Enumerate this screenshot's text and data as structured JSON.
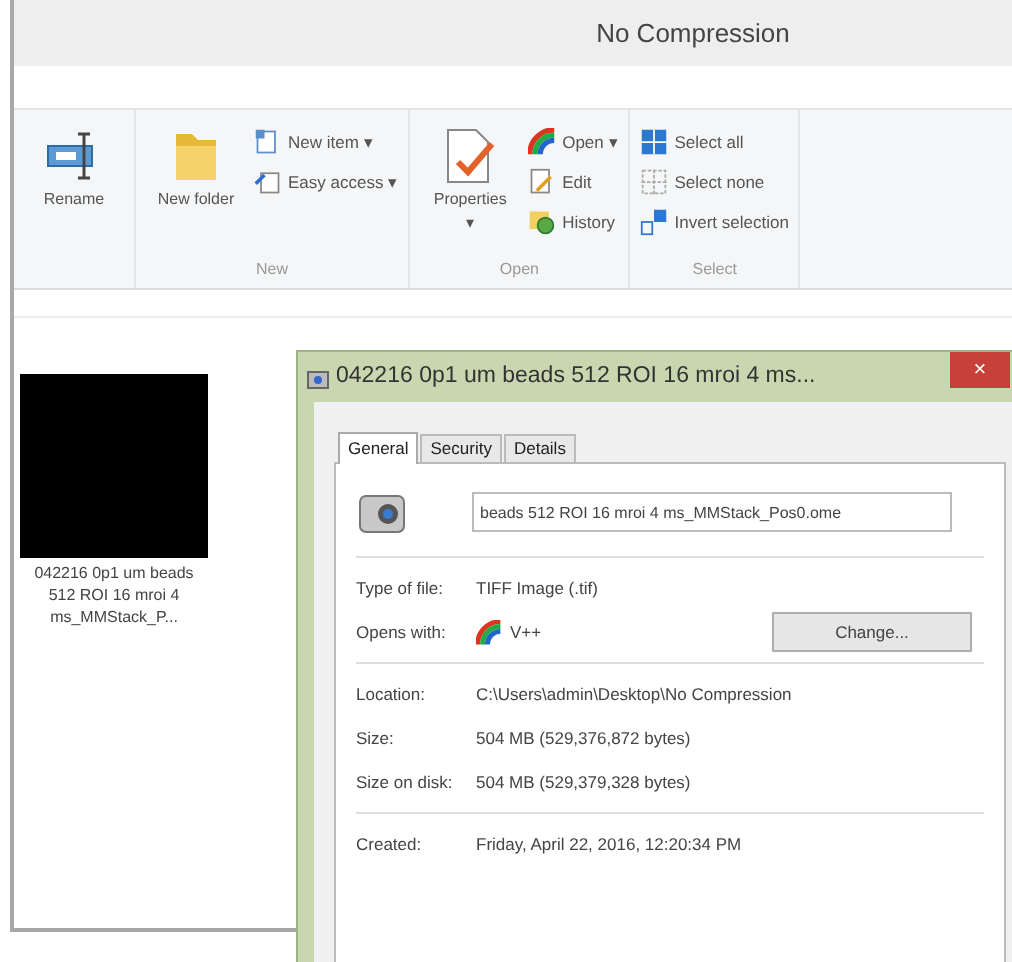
{
  "window": {
    "title": "No Compression"
  },
  "ribbon": {
    "groups": [
      {
        "large": [
          {
            "label": "Rename"
          }
        ]
      },
      {
        "label": "New",
        "large": [
          {
            "label": "New folder"
          }
        ],
        "small": [
          {
            "label": "New item",
            "dropdown": true
          },
          {
            "label": "Easy access",
            "dropdown": true
          }
        ]
      },
      {
        "label": "Open",
        "large": [
          {
            "label": "Properties",
            "dropdown": true
          }
        ],
        "small": [
          {
            "label": "Open",
            "dropdown": true
          },
          {
            "label": "Edit",
            "dropdown": false
          },
          {
            "label": "History",
            "dropdown": false
          }
        ]
      },
      {
        "label": "Select",
        "small": [
          {
            "label": "Select all",
            "dropdown": false
          },
          {
            "label": "Select none",
            "dropdown": false
          },
          {
            "label": "Invert selection",
            "dropdown": false
          }
        ]
      }
    ],
    "dropdown_mark": "▾"
  },
  "file": {
    "name": "042216 0p1 um beads 512 ROI 16 mroi 4 ms_MMStack_P..."
  },
  "dialog": {
    "title": "042216 0p1 um beads 512 ROI 16 mroi 4 ms...",
    "close": "×",
    "tabs": [
      {
        "label": "General",
        "selected": true
      },
      {
        "label": "Security",
        "selected": false
      },
      {
        "label": "Details",
        "selected": false
      }
    ],
    "name_value": "beads 512 ROI 16 mroi 4 ms_MMStack_Pos0.ome",
    "sections": [
      [
        {
          "label": "Type of file:",
          "value": "TIFF Image (.tif)"
        },
        {
          "label": "Opens with:",
          "value": "V++",
          "button": "Change..."
        }
      ],
      [
        {
          "label": "Location:",
          "value": "C:\\Users\\admin\\Desktop\\No Compression"
        },
        {
          "label": "Size:",
          "value": "504 MB (529,376,872 bytes)"
        },
        {
          "label": "Size on disk:",
          "value": "504 MB (529,379,328 bytes)"
        }
      ],
      [
        {
          "label": "Created:",
          "value": "Friday, April 22, 2016, 12:20:34 PM"
        }
      ]
    ]
  }
}
